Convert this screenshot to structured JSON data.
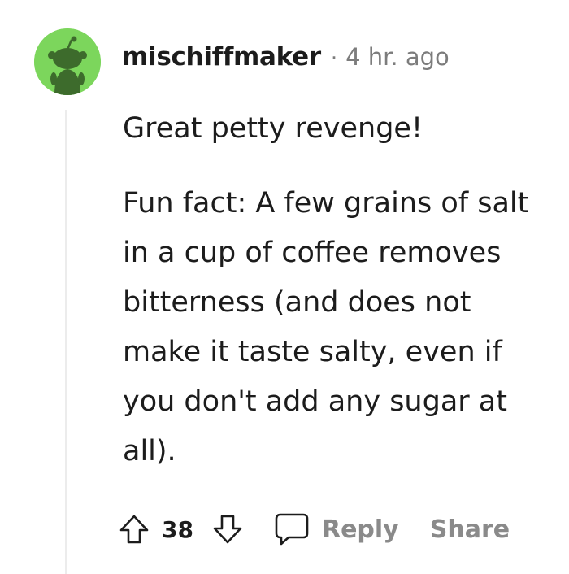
{
  "comment": {
    "author": "mischiffmaker",
    "separator": "·",
    "timestamp": "4 hr. ago",
    "body": [
      "Great petty revenge!",
      "Fun fact: A few grains of salt in a cup of coffee removes bitterness (and does not make it taste salty, even if you don't add any sugar at all)."
    ],
    "vote_count": "38",
    "reply_label": "Reply",
    "share_label": "Share"
  },
  "icons": {
    "avatar": "snoo-avatar",
    "upvote": "upvote-arrow-icon",
    "downvote": "downvote-arrow-icon",
    "reply": "comment-bubble-icon"
  },
  "colors": {
    "avatar_bg": "#7cd65c",
    "text": "#1c1c1c",
    "meta": "#7c7c7c",
    "action": "#8a8a8a",
    "thread_line": "#ececec"
  }
}
